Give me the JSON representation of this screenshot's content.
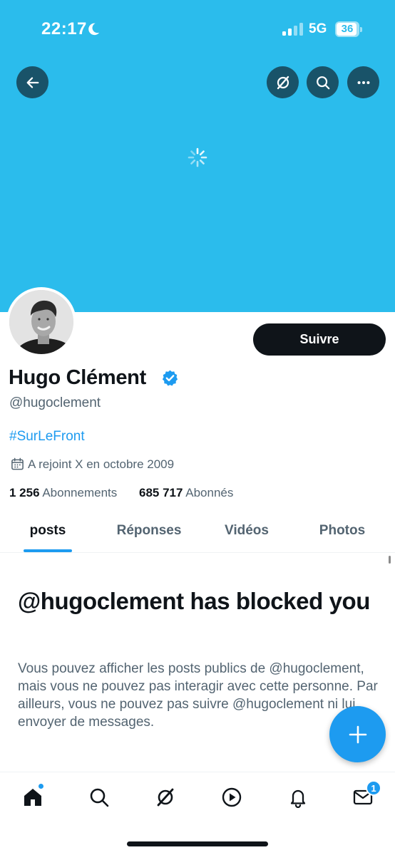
{
  "status_bar": {
    "time": "22:17",
    "network": "5G",
    "battery": "36"
  },
  "profile": {
    "display_name": "Hugo Clément",
    "handle": "@hugoclement",
    "bio_hashtag": "#SurLeFront",
    "joined": "A rejoint X en octobre 2009",
    "following_count": "1 256",
    "following_label": "Abonnements",
    "followers_count": "685 717",
    "followers_label": "Abonnés",
    "follow_button_label": "Suivre"
  },
  "tabs": [
    {
      "label": "posts",
      "active": true
    },
    {
      "label": "Réponses",
      "active": false
    },
    {
      "label": "Vidéos",
      "active": false
    },
    {
      "label": "Photos",
      "active": false
    }
  ],
  "blocked": {
    "title": "@hugoclement has blocked you",
    "message": "Vous pouvez afficher les posts publics de @hugoclement, mais vous ne pouvez pas interagir avec cette personne. Par ailleurs, vous ne pouvez pas suivre @hugoclement ni lui envoyer de messages."
  },
  "bottom_nav": {
    "messages_badge": "1"
  },
  "colors": {
    "banner": "#2bbcec",
    "accent": "#1d9bf0",
    "text_primary": "#0f1419",
    "text_secondary": "#536471"
  },
  "icons": {
    "top_bar": [
      "back-arrow-icon",
      "grok-icon",
      "search-icon",
      "more-icon"
    ],
    "bottom_nav": [
      "home-icon",
      "search-icon",
      "grok-icon",
      "video-icon",
      "bell-icon",
      "mail-icon"
    ]
  }
}
